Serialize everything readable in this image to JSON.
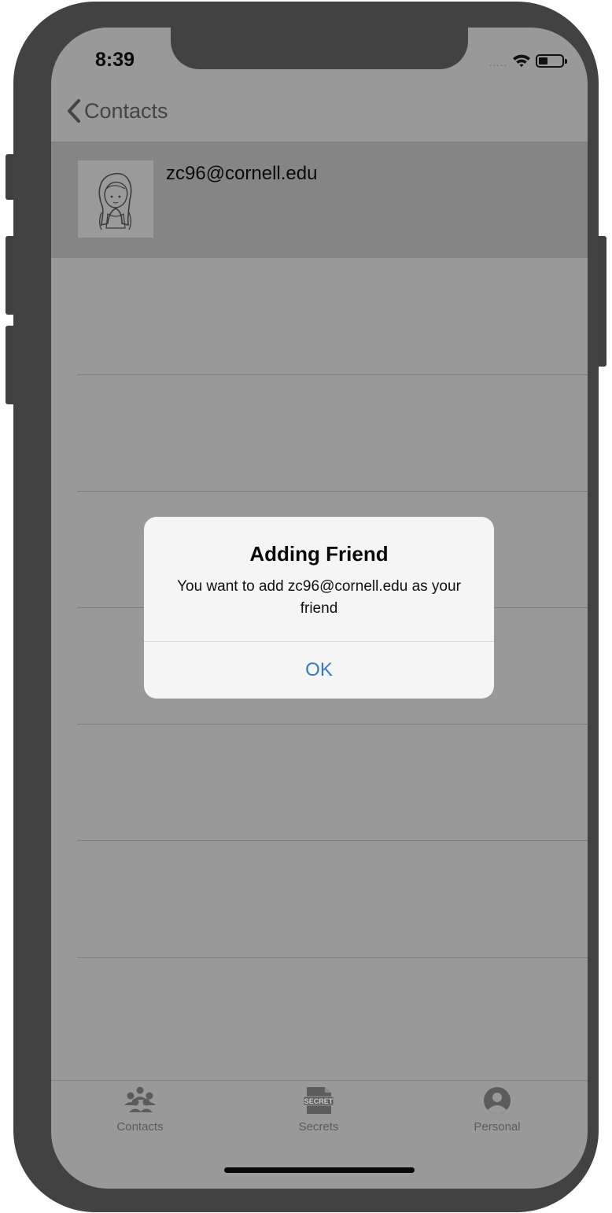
{
  "status_bar": {
    "time": "8:39",
    "signal": "....."
  },
  "nav": {
    "back_label": "Contacts"
  },
  "contact": {
    "email": "zc96@cornell.edu"
  },
  "alert": {
    "title": "Adding Friend",
    "message": "You want to add zc96@cornell.edu as your friend",
    "ok_label": "OK"
  },
  "tabbar": {
    "contacts_label": "Contacts",
    "secrets_label": "Secrets",
    "secret_icon_text": "SECRET",
    "personal_label": "Personal"
  },
  "colors": {
    "dimmed_background": "#999999",
    "selected_row": "#858585",
    "alert_background": "#f5f5f5",
    "alert_button": "#3478c8"
  }
}
